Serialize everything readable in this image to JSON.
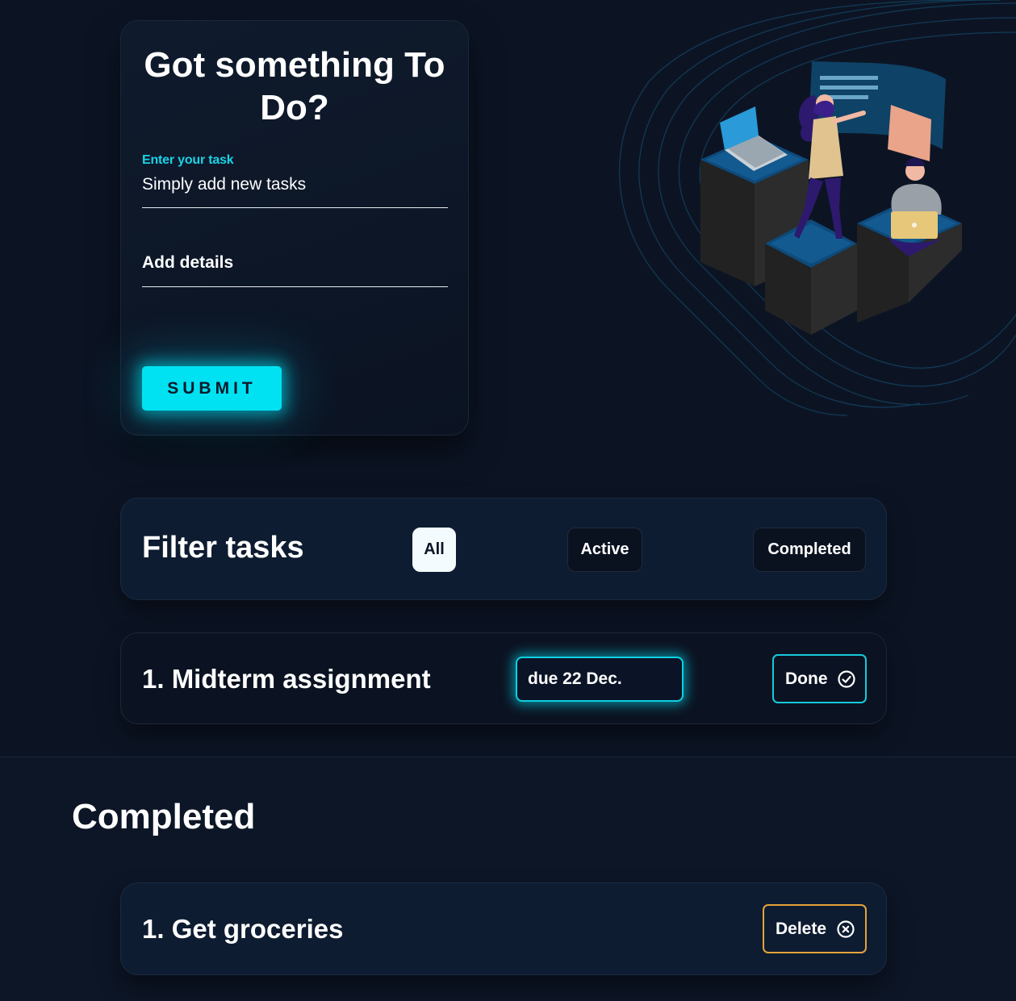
{
  "form": {
    "title": "Got something To Do?",
    "task_label": "Enter your task",
    "task_value": "Simply add new tasks",
    "details_placeholder": "Add details",
    "submit_label": "SUBMIT"
  },
  "filter": {
    "title": "Filter tasks",
    "options": [
      "All",
      "Active",
      "Completed"
    ],
    "selected": "All"
  },
  "active_tasks": [
    {
      "title": "1. Midterm assignment",
      "due": "due 22 Dec.",
      "action_label": "Done",
      "action_icon": "check-circle-icon"
    }
  ],
  "completed": {
    "heading": "Completed",
    "tasks": [
      {
        "title": "1. Get groceries",
        "action_label": "Delete",
        "action_icon": "x-circle-icon"
      }
    ]
  },
  "colors": {
    "background": "#0c1424",
    "accent_cyan": "#00e2f2",
    "delete_orange": "#e5a33a"
  }
}
